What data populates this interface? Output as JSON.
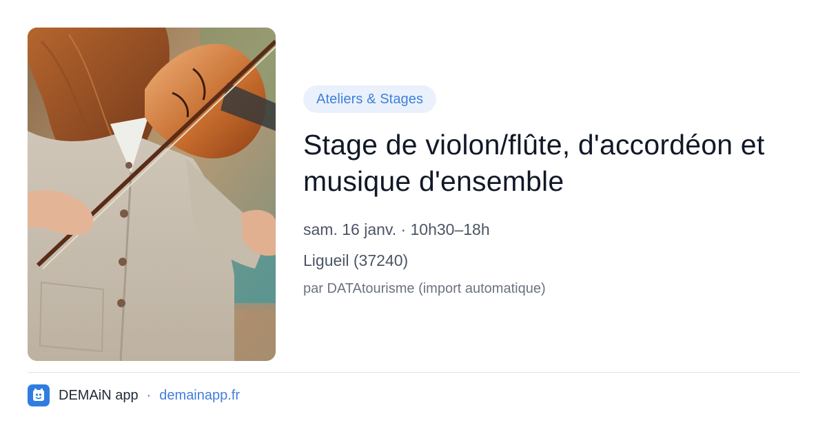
{
  "event": {
    "category": "Ateliers & Stages",
    "title": "Stage de violon/flûte, d'accordéon et musique d'ensemble",
    "datetime": "sam. 16 janv. · 10h30–18h",
    "location": "Ligueil (37240)",
    "source": "par DATAtourisme (import automatique)"
  },
  "footer": {
    "app_name": "DEMAiN app",
    "separator": "·",
    "url": "demainapp.fr"
  },
  "image": {
    "subject": "person-playing-violin-photo"
  },
  "colors": {
    "accent": "#3f7fd8",
    "pill_bg": "#eaf1fc",
    "title": "#111827",
    "meta": "#4b5563",
    "divider": "#dde3e8",
    "logo_bg": "#2f7de0"
  }
}
